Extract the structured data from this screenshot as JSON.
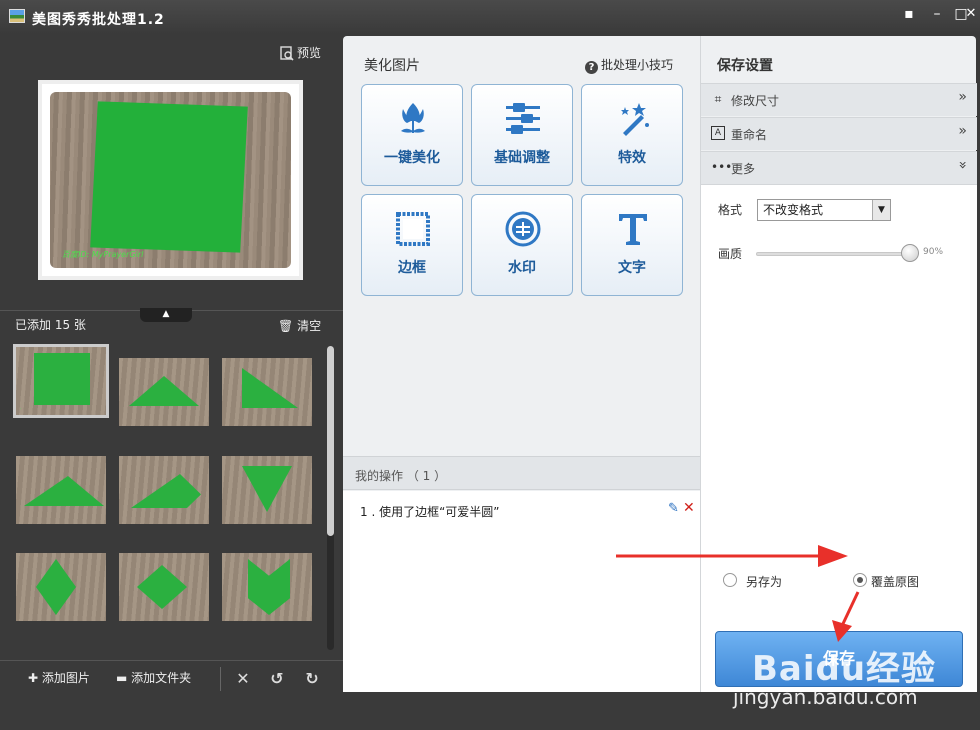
{
  "window": {
    "title": "美图秀秀批处理1.2",
    "buttons": [
      "chat-icon",
      "minimize-icon",
      "maximize-icon",
      "close-icon"
    ]
  },
  "left": {
    "preview_label": "预览",
    "preview_watermark": "百度ID: MyPrayerGirl",
    "added_count": "已添加 15 张",
    "clear_label": "清空",
    "thumb_count": 9,
    "bottom": {
      "add_image": "添加图片",
      "add_folder": "添加文件夹"
    }
  },
  "mid": {
    "title": "美化图片",
    "tips": "批处理小技巧",
    "tiles": [
      {
        "label": "一键美化",
        "icon": "tulip-icon"
      },
      {
        "label": "基础调整",
        "icon": "sliders-icon"
      },
      {
        "label": "特效",
        "icon": "magic-wand-icon"
      },
      {
        "label": "边框",
        "icon": "frame-icon"
      },
      {
        "label": "水印",
        "icon": "watermark-seal-icon"
      },
      {
        "label": "文字",
        "icon": "text-icon"
      }
    ],
    "ops_title": "我的操作 （ 1 ）",
    "ops_item": "1 . 使用了边框“可爱半圆”"
  },
  "right": {
    "title": "保存设置",
    "acc": {
      "resize": "修改尺寸",
      "rename": "重命名",
      "more": "更多"
    },
    "format_label": "格式",
    "format_value": "不改变格式",
    "quality_label": "画质",
    "quality_value": "90%",
    "quality_level": 0.9,
    "save_as": "另存为",
    "overwrite": "覆盖原图",
    "save_button": "保存"
  },
  "watermark": {
    "baidu": "Baidu经验",
    "url": "jingyan.baidu.com"
  },
  "colors": {
    "accent": "#3e87d6",
    "arrow": "#e8302a",
    "paper_green": "#23b03a"
  }
}
